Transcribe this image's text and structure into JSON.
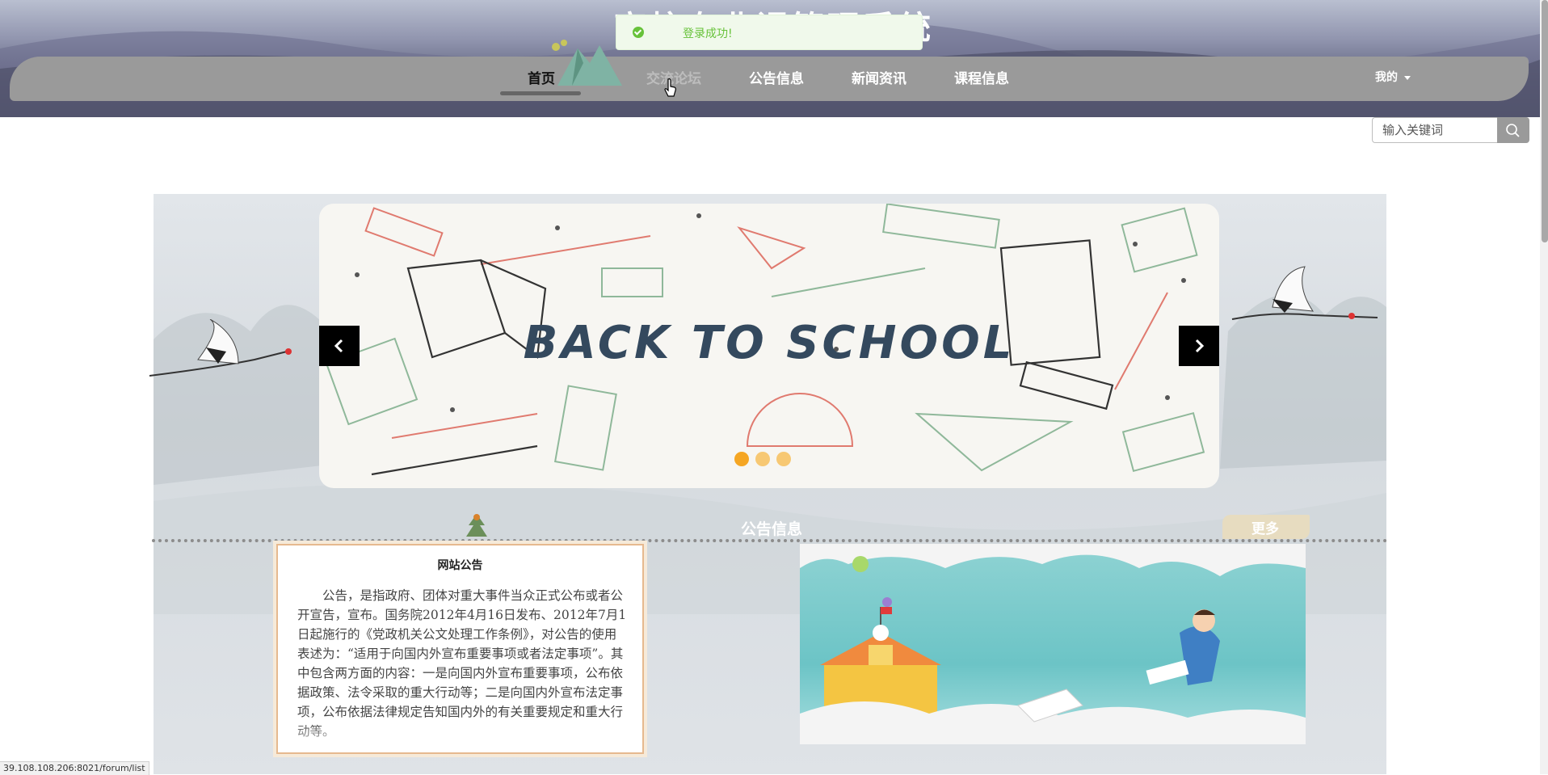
{
  "header": {
    "site_title": "高校专业课管理系统",
    "nav": [
      {
        "label": "首页"
      },
      {
        "label": "交流论坛"
      },
      {
        "label": "公告信息"
      },
      {
        "label": "新闻资讯"
      },
      {
        "label": "课程信息"
      }
    ],
    "user_menu_label": "我的"
  },
  "toast": {
    "message": "登录成功!"
  },
  "search": {
    "placeholder": "输入关键词"
  },
  "carousel": {
    "headline": "BACK TO SCHOOL",
    "slide_count": 3,
    "active_index": 0,
    "dot_color": "#f5a623"
  },
  "notice_section": {
    "title": "公告信息",
    "more_label": "更多",
    "card_heading": "网站公告",
    "card_body": "公告，是指政府、团体对重大事件当众正式公布或者公开宣告，宣布。国务院2012年4月16日发布、2012年7月1日起施行的《党政机关公文处理工作条例》，对公告的使用表述为：“适用于向国内外宣布重要事项或者法定事项”。其中包含两方面的内容：一是向国内外宣布重要事项，公布依据政策、法令采取的重大行动等；二是向国内外宣布法定事项，公布依据法律规定告知国内外的有关重要规定和重大行动等。"
  },
  "status_bar": {
    "url": "39.108.108.206:8021/forum/list"
  },
  "colors": {
    "nav_bar": "#9a9a9a",
    "toast_bg": "#f0f9eb",
    "toast_text": "#67c23a",
    "card_border": "#e6b98f"
  }
}
